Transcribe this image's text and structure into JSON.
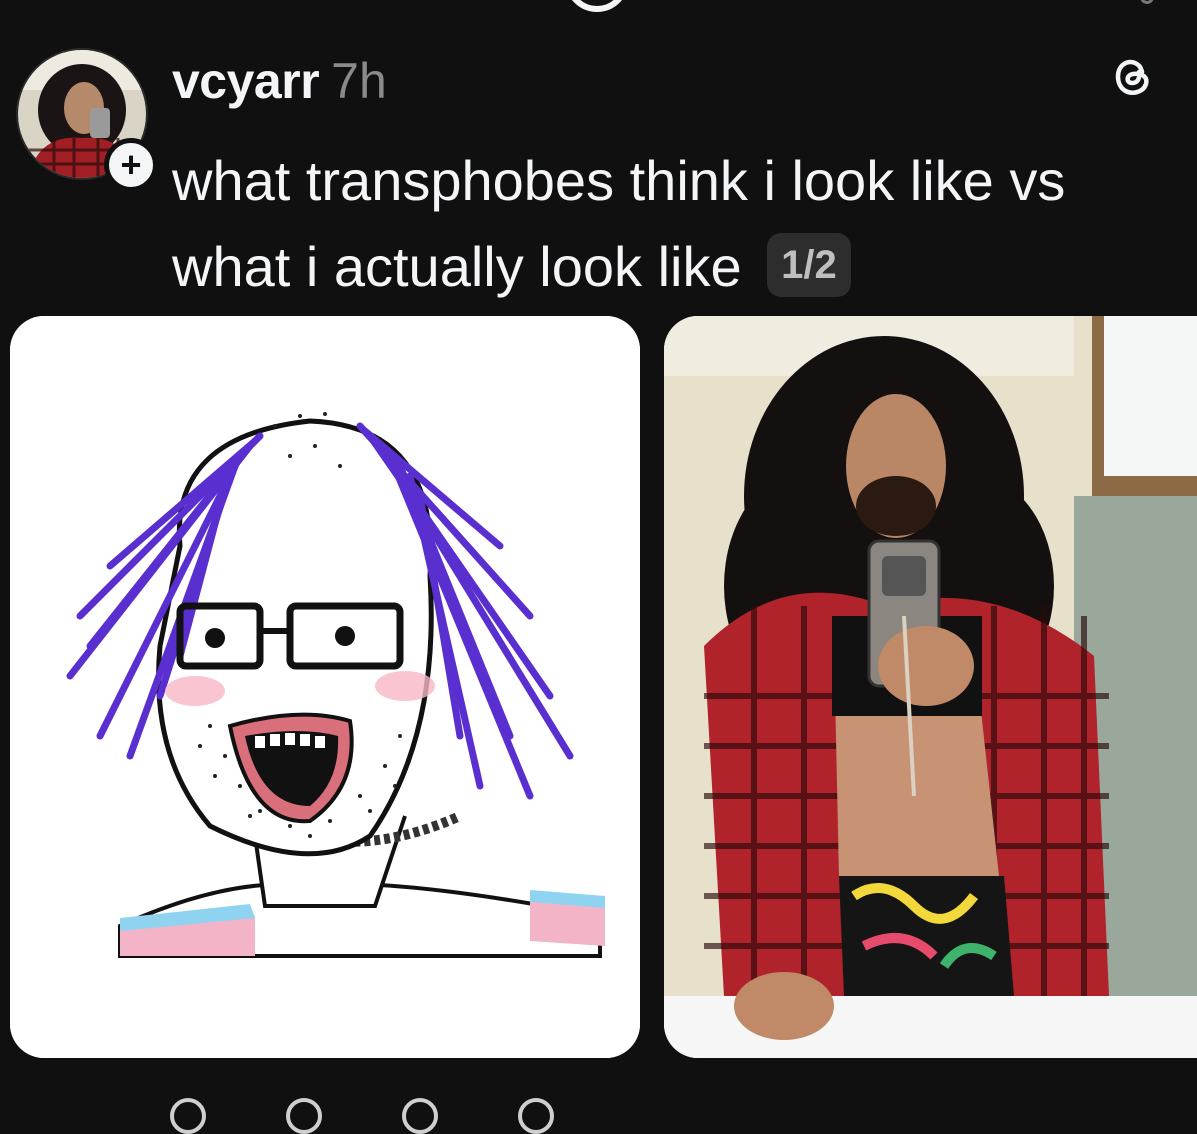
{
  "post": {
    "username": "vcyarr",
    "timestamp": "7h",
    "text": "what transphobes think i look like vs what i actually look like",
    "page_indicator": "1/2"
  },
  "icons": {
    "avatar": "user-avatar",
    "follow": "plus-icon",
    "app": "threads-logo-icon",
    "like": "heart-icon",
    "reply": "comment-icon",
    "repost": "repost-icon",
    "share": "share-icon"
  },
  "colors": {
    "background": "#101010",
    "text": "#f3f5f7",
    "muted": "#8a8a8a",
    "badge_bg": "#2d2d2d"
  }
}
